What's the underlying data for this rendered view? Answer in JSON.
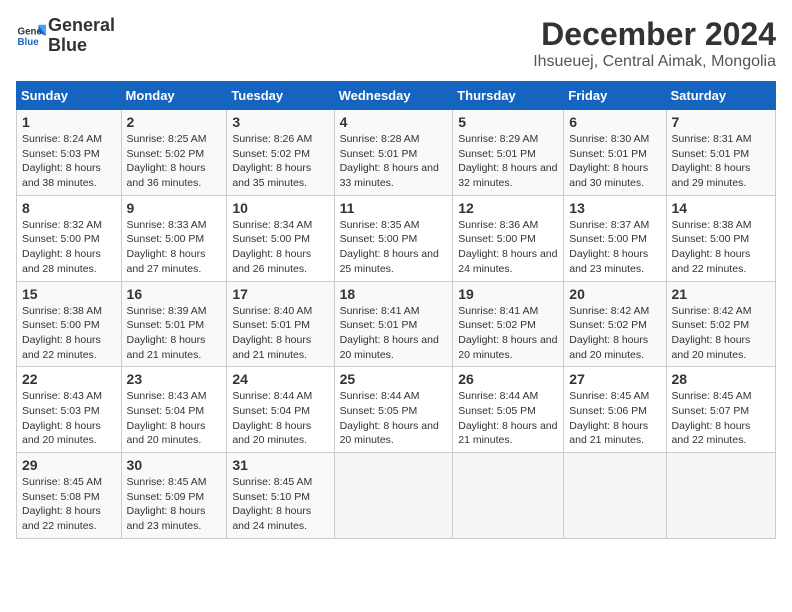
{
  "logo": {
    "line1": "General",
    "line2": "Blue"
  },
  "title": "December 2024",
  "subtitle": "Ihsueuej, Central Aimak, Mongolia",
  "days_of_week": [
    "Sunday",
    "Monday",
    "Tuesday",
    "Wednesday",
    "Thursday",
    "Friday",
    "Saturday"
  ],
  "weeks": [
    [
      {
        "day": "1",
        "info": "Sunrise: 8:24 AM\nSunset: 5:03 PM\nDaylight: 8 hours and 38 minutes."
      },
      {
        "day": "2",
        "info": "Sunrise: 8:25 AM\nSunset: 5:02 PM\nDaylight: 8 hours and 36 minutes."
      },
      {
        "day": "3",
        "info": "Sunrise: 8:26 AM\nSunset: 5:02 PM\nDaylight: 8 hours and 35 minutes."
      },
      {
        "day": "4",
        "info": "Sunrise: 8:28 AM\nSunset: 5:01 PM\nDaylight: 8 hours and 33 minutes."
      },
      {
        "day": "5",
        "info": "Sunrise: 8:29 AM\nSunset: 5:01 PM\nDaylight: 8 hours and 32 minutes."
      },
      {
        "day": "6",
        "info": "Sunrise: 8:30 AM\nSunset: 5:01 PM\nDaylight: 8 hours and 30 minutes."
      },
      {
        "day": "7",
        "info": "Sunrise: 8:31 AM\nSunset: 5:01 PM\nDaylight: 8 hours and 29 minutes."
      }
    ],
    [
      {
        "day": "8",
        "info": "Sunrise: 8:32 AM\nSunset: 5:00 PM\nDaylight: 8 hours and 28 minutes."
      },
      {
        "day": "9",
        "info": "Sunrise: 8:33 AM\nSunset: 5:00 PM\nDaylight: 8 hours and 27 minutes."
      },
      {
        "day": "10",
        "info": "Sunrise: 8:34 AM\nSunset: 5:00 PM\nDaylight: 8 hours and 26 minutes."
      },
      {
        "day": "11",
        "info": "Sunrise: 8:35 AM\nSunset: 5:00 PM\nDaylight: 8 hours and 25 minutes."
      },
      {
        "day": "12",
        "info": "Sunrise: 8:36 AM\nSunset: 5:00 PM\nDaylight: 8 hours and 24 minutes."
      },
      {
        "day": "13",
        "info": "Sunrise: 8:37 AM\nSunset: 5:00 PM\nDaylight: 8 hours and 23 minutes."
      },
      {
        "day": "14",
        "info": "Sunrise: 8:38 AM\nSunset: 5:00 PM\nDaylight: 8 hours and 22 minutes."
      }
    ],
    [
      {
        "day": "15",
        "info": "Sunrise: 8:38 AM\nSunset: 5:00 PM\nDaylight: 8 hours and 22 minutes."
      },
      {
        "day": "16",
        "info": "Sunrise: 8:39 AM\nSunset: 5:01 PM\nDaylight: 8 hours and 21 minutes."
      },
      {
        "day": "17",
        "info": "Sunrise: 8:40 AM\nSunset: 5:01 PM\nDaylight: 8 hours and 21 minutes."
      },
      {
        "day": "18",
        "info": "Sunrise: 8:41 AM\nSunset: 5:01 PM\nDaylight: 8 hours and 20 minutes."
      },
      {
        "day": "19",
        "info": "Sunrise: 8:41 AM\nSunset: 5:02 PM\nDaylight: 8 hours and 20 minutes."
      },
      {
        "day": "20",
        "info": "Sunrise: 8:42 AM\nSunset: 5:02 PM\nDaylight: 8 hours and 20 minutes."
      },
      {
        "day": "21",
        "info": "Sunrise: 8:42 AM\nSunset: 5:02 PM\nDaylight: 8 hours and 20 minutes."
      }
    ],
    [
      {
        "day": "22",
        "info": "Sunrise: 8:43 AM\nSunset: 5:03 PM\nDaylight: 8 hours and 20 minutes."
      },
      {
        "day": "23",
        "info": "Sunrise: 8:43 AM\nSunset: 5:04 PM\nDaylight: 8 hours and 20 minutes."
      },
      {
        "day": "24",
        "info": "Sunrise: 8:44 AM\nSunset: 5:04 PM\nDaylight: 8 hours and 20 minutes."
      },
      {
        "day": "25",
        "info": "Sunrise: 8:44 AM\nSunset: 5:05 PM\nDaylight: 8 hours and 20 minutes."
      },
      {
        "day": "26",
        "info": "Sunrise: 8:44 AM\nSunset: 5:05 PM\nDaylight: 8 hours and 21 minutes."
      },
      {
        "day": "27",
        "info": "Sunrise: 8:45 AM\nSunset: 5:06 PM\nDaylight: 8 hours and 21 minutes."
      },
      {
        "day": "28",
        "info": "Sunrise: 8:45 AM\nSunset: 5:07 PM\nDaylight: 8 hours and 22 minutes."
      }
    ],
    [
      {
        "day": "29",
        "info": "Sunrise: 8:45 AM\nSunset: 5:08 PM\nDaylight: 8 hours and 22 minutes."
      },
      {
        "day": "30",
        "info": "Sunrise: 8:45 AM\nSunset: 5:09 PM\nDaylight: 8 hours and 23 minutes."
      },
      {
        "day": "31",
        "info": "Sunrise: 8:45 AM\nSunset: 5:10 PM\nDaylight: 8 hours and 24 minutes."
      },
      {
        "day": "",
        "info": ""
      },
      {
        "day": "",
        "info": ""
      },
      {
        "day": "",
        "info": ""
      },
      {
        "day": "",
        "info": ""
      }
    ]
  ]
}
